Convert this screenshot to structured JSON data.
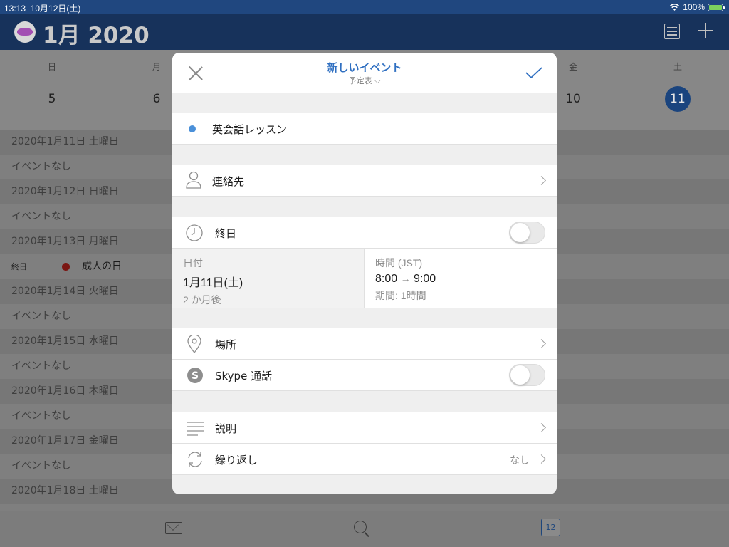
{
  "status": {
    "time": "13:13",
    "date": "10月12日(土)",
    "battery": "100%"
  },
  "header": {
    "title": "1月 2020"
  },
  "week": {
    "day_names": [
      "日",
      "月",
      "金",
      "土"
    ],
    "dates": [
      "5",
      "6",
      "10",
      "11"
    ]
  },
  "agenda": [
    {
      "date": "2020年1月11日 土曜日",
      "event": "イベントなし"
    },
    {
      "date": "2020年1月12日 日曜日",
      "event": "イベントなし"
    },
    {
      "date": "2020年1月13日 月曜日",
      "allday_label": "終日",
      "event_title": "成人の日"
    },
    {
      "date": "2020年1月14日 火曜日",
      "event": "イベントなし"
    },
    {
      "date": "2020年1月15日 水曜日",
      "event": "イベントなし"
    },
    {
      "date": "2020年1月16日 木曜日",
      "event": "イベントなし"
    },
    {
      "date": "2020年1月17日 金曜日",
      "event": "イベントなし"
    },
    {
      "date": "2020年1月18日 土曜日"
    }
  ],
  "tabbar": {
    "calendar_day": "12"
  },
  "modal": {
    "title": "新しいイベント",
    "subtitle": "予定表 ⌵",
    "event_name": "英会話レッスン",
    "contacts": "連絡先",
    "all_day": "終日",
    "date_label": "日付",
    "date_value": "1月11日(土)",
    "date_relative": "2 か月後",
    "time_label": "時間 (JST)",
    "time_start": "8:00",
    "time_arrow": "→",
    "time_end": "9:00",
    "duration": "期間: 1時間",
    "location": "場所",
    "skype": "Skype 通話",
    "description": "説明",
    "repeat": "繰り返し",
    "repeat_value": "なし"
  }
}
